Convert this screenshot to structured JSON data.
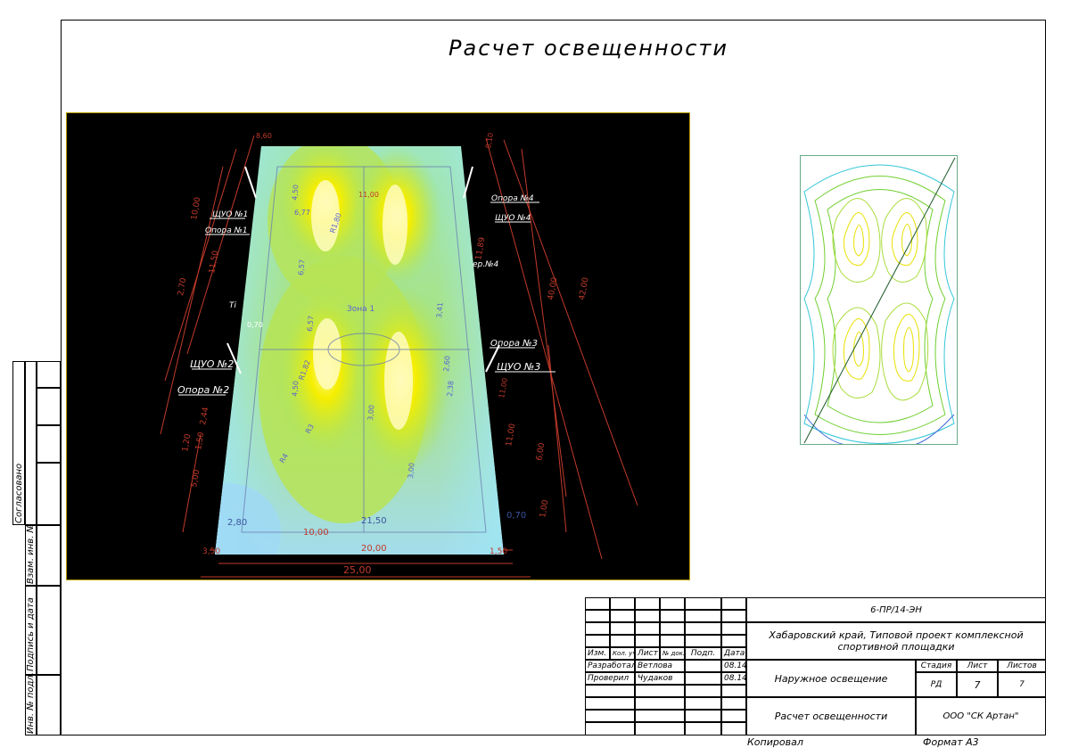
{
  "title": "Расчет освещенности",
  "left_strip": {
    "agreed": "Согласовано",
    "ref_no": "Взам. инв. №",
    "sign_date": "Подпись и дата",
    "inv_no": "Инв. № подл."
  },
  "plan": {
    "labels": {
      "zone": "Зона 1",
      "shchuo1": "ЩУО №1",
      "opora1": "Опора №1",
      "shchuo2": "ЩУО №2",
      "opora2": "Опора №2",
      "opora3": "Опора №3",
      "shchuo3": "ЩУО №3",
      "opora4": "Опора №4",
      "shchuo4": "ЩУО №4",
      "opora4b": "ер.№4",
      "ti": "Ti"
    },
    "dims": {
      "d_bottom_total": "25,00",
      "d_bottom_field": "20,00",
      "d_bottom_inner": "10,00",
      "d_bottom_left": "3,50",
      "d_bottom_right": "1,50",
      "d_mid_2150": "21,50",
      "d_280": "2,80",
      "d_070": "0,70",
      "d_070b": "0,70",
      "d_100": "1,00",
      "d_600": "6,00",
      "d_1100": "11,00",
      "d_4000": "40,00",
      "d_4200": "42,00",
      "d_1100b": "11,00",
      "d_500": "5,00",
      "d_300": "3,00",
      "d_300b": "3,00",
      "d_657": "6,57",
      "d_657b": "6,57",
      "d_450": "4,50",
      "d_450b": "4,50",
      "d_677": "6,77",
      "d_r4": "R4",
      "d_r3": "R3",
      "d_r1": "R1,82",
      "d_r2": "R1,80",
      "d_860": "8,60",
      "d_1100c": "11,00",
      "d_341": "3,41",
      "d_260": "2,60",
      "d_238": "2,38",
      "d_270": "2,70",
      "d_120": "1,20",
      "d_150": "1,50",
      "d_244": "2,44",
      "d_810": "8,10",
      "d_1000": "10,00",
      "d_1150": "11,50",
      "d_1189": "11,89"
    }
  },
  "stamp": {
    "code": "6-ПР/14-ЭН",
    "project": "Хабаровский край, Типовой проект комплексной спортивной площадки",
    "section": "Наружное освещение",
    "sheet_title": "Расчет освещенности",
    "company": "ООО \"СК Артан\"",
    "headers": {
      "izm": "Изм.",
      "kol": "Кол. уч",
      "list": "Лист",
      "ndok": "№ док.",
      "podp": "Подп.",
      "data": "Дата"
    },
    "stage_h": "Стадия",
    "sheet_h": "Лист",
    "sheets_h": "Листов",
    "stage": "РД",
    "sheet": "7",
    "sheets": "7",
    "rows": [
      {
        "role": "Разработал",
        "name": "Ветлова",
        "date": "08.14"
      },
      {
        "role": "Проверил",
        "name": "Чудаков",
        "date": "08.14"
      }
    ]
  },
  "footer": {
    "copied": "Копировал",
    "format": "Формат А3"
  },
  "colors": {
    "iso_green": "#6fcf2e",
    "iso_yellow": "#e8e000",
    "iso_cyan": "#35c6d8",
    "iso_blue": "#3c6ad8",
    "iso_diag": "#1d5a2a"
  }
}
